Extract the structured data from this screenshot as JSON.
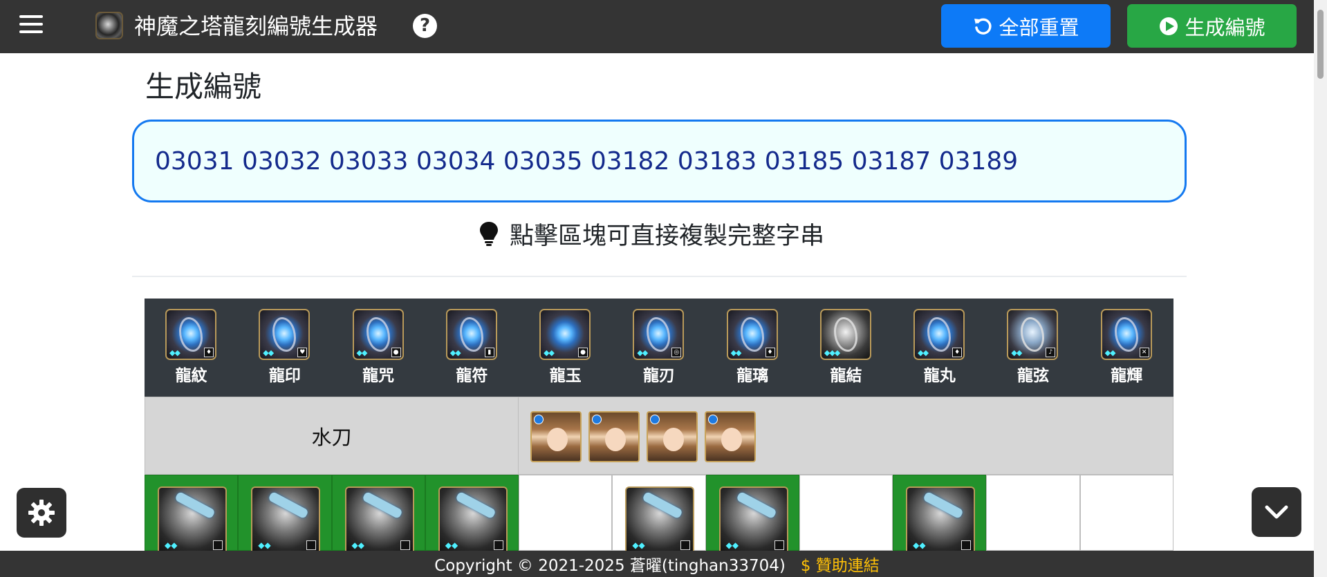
{
  "navbar": {
    "title": "神魔之塔龍刻編號生成器",
    "help_symbol": "?",
    "reset_label": "全部重置",
    "generate_label": "生成編號"
  },
  "main": {
    "section_title": "生成編號",
    "code_output": "03031 03032 03033 03034 03035 03182 03183 03185 03187 03189",
    "hint": "點擊區塊可直接複製完整字串"
  },
  "items": [
    {
      "label": "龍紋",
      "icon": "dragon-pattern-icon"
    },
    {
      "label": "龍印",
      "icon": "dragon-seal-icon"
    },
    {
      "label": "龍咒",
      "icon": "dragon-curse-icon"
    },
    {
      "label": "龍符",
      "icon": "dragon-talisman-icon"
    },
    {
      "label": "龍玉",
      "icon": "dragon-jade-icon"
    },
    {
      "label": "龍刃",
      "icon": "dragon-edge-icon"
    },
    {
      "label": "龍璃",
      "icon": "dragon-glass-icon"
    },
    {
      "label": "龍結",
      "icon": "dragon-knot-icon"
    },
    {
      "label": "龍丸",
      "icon": "dragon-pill-icon"
    },
    {
      "label": "龍弦",
      "icon": "dragon-string-icon"
    },
    {
      "label": "龍輝",
      "icon": "dragon-radiance-icon"
    }
  ],
  "set": {
    "name": "水刀",
    "characters": 4
  },
  "selection": [
    true,
    true,
    true,
    true,
    false,
    false,
    true,
    false,
    true,
    false,
    false
  ],
  "blade_slots_visible": [
    true,
    true,
    true,
    true,
    false,
    true,
    true,
    false,
    true,
    false,
    false
  ],
  "footer": {
    "copyright": "Copyright © 2021-2025 蒼曜(tinghan33704)",
    "sponsor": "$ 贊助連結"
  },
  "colors": {
    "navbar": "#343434",
    "reset_button": "#0d7af7",
    "generate_button": "#28a745",
    "code_border": "#1479f0",
    "code_background": "#effffe",
    "code_text": "#142a8c",
    "selected_slot": "#22922b",
    "sponsor": "#ffc107"
  }
}
